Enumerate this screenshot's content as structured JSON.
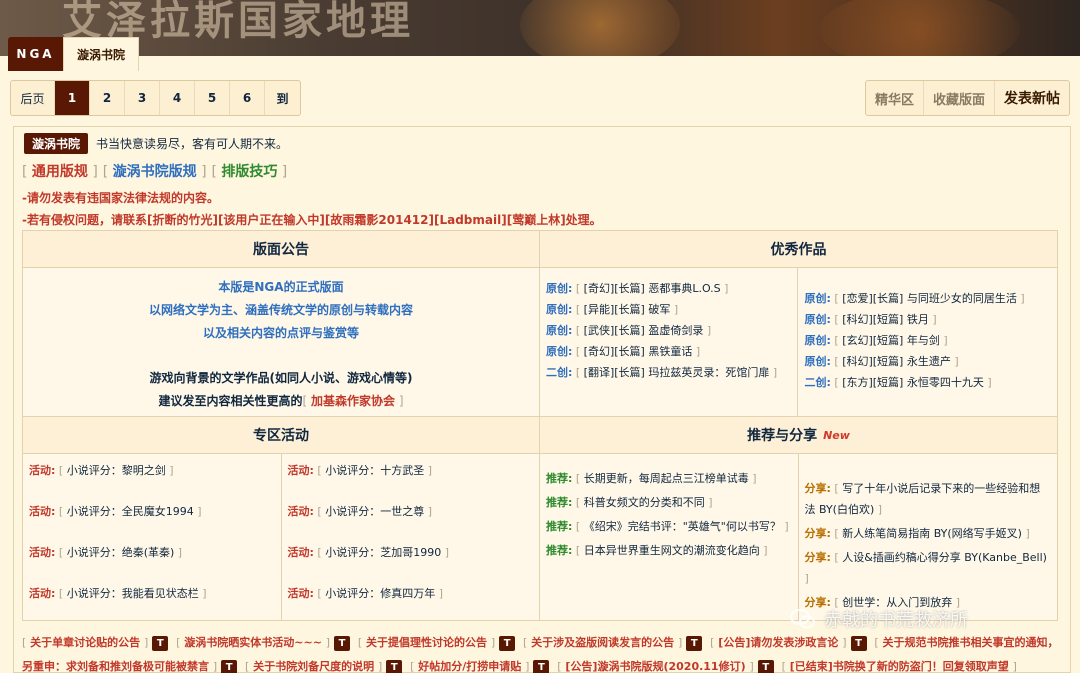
{
  "banner": {
    "title": "艾泽拉斯国家地理"
  },
  "breadcrumb": {
    "site": "NGA",
    "board": "漩涡书院"
  },
  "pager": {
    "prev": "后页",
    "pages": [
      "1",
      "2",
      "3",
      "4",
      "5",
      "6"
    ],
    "current": "1",
    "goto": "到"
  },
  "toolbar": {
    "featured": "精华区",
    "favorite": "收藏版面",
    "new_post": "发表新帖"
  },
  "intro": {
    "tag": "漩涡书院",
    "text": "书当快意读易尽，客有可人期不来。"
  },
  "rule_links": [
    "通用版规",
    "漩涡书院版规",
    "排版技巧"
  ],
  "warnings": [
    "-请勿发表有违国家法律法规的内容。",
    "-若有侵权问题，请联系[折断的竹光][该用户正在输入中][故雨霜影201412][Ladbmail][莺巅上林]处理。"
  ],
  "sections": {
    "announcement": {
      "title": "版面公告",
      "lines_blue": [
        "本版是NGA的正式版面",
        "以网络文学为主、涵盖传统文学的原创与转载内容",
        "以及相关内容的点评与鉴赏等"
      ],
      "lines_dark": [
        "游戏向背景的文学作品(如同人小说、游戏心情等)",
        "建议发至内容相关性更高的"
      ],
      "link": "加基森作家协会"
    },
    "works": {
      "title": "优秀作品",
      "left": [
        {
          "label": "原创:",
          "text": "[奇幻][长篇] 恶都事典L.O.S"
        },
        {
          "label": "原创:",
          "text": "[异能][长篇] 破军"
        },
        {
          "label": "原创:",
          "text": "[武侠][长篇] 盈虚倚剑录"
        },
        {
          "label": "原创:",
          "text": "[奇幻][长篇] 黑铁童话"
        },
        {
          "label": "二创:",
          "text": "[翻译][长篇] 玛拉兹英灵录：死馆门扉"
        }
      ],
      "right": [
        {
          "label": "原创:",
          "text": "[恋爱][长篇] 与同班少女的同居生活"
        },
        {
          "label": "原创:",
          "text": "[科幻][短篇] 铁月"
        },
        {
          "label": "原创:",
          "text": "[玄幻][短篇] 年与剑"
        },
        {
          "label": "原创:",
          "text": "[科幻][短篇] 永生遗产"
        },
        {
          "label": "二创:",
          "text": "[东方][短篇] 永恒零四十九天"
        }
      ]
    },
    "activities": {
      "title": "专区活动",
      "col1": [
        {
          "label": "活动:",
          "text": "小说评分：黎明之剑"
        },
        {
          "label": "活动:",
          "text": "小说评分：全民魔女1994"
        },
        {
          "label": "活动:",
          "text": "小说评分：绝秦(革秦)"
        },
        {
          "label": "活动:",
          "text": "小说评分：我能看见状态栏"
        }
      ],
      "col2": [
        {
          "label": "活动:",
          "text": "小说评分：十方武圣"
        },
        {
          "label": "活动:",
          "text": "小说评分：一世之尊"
        },
        {
          "label": "活动:",
          "text": "小说评分：芝加哥1990"
        },
        {
          "label": "活动:",
          "text": "小说评分：修真四万年"
        }
      ]
    },
    "recommend": {
      "title": "推荐与分享",
      "badge": "New",
      "left": [
        {
          "label": "推荐:",
          "text": "长期更新，每周起点三江榜单试毒"
        },
        {
          "label": "推荐:",
          "text": "科普女频文的分类和不同"
        },
        {
          "label": "推荐:",
          "text": "《绍宋》完结书评：\"英雄气\"何以书写？"
        },
        {
          "label": "推荐:",
          "text": "日本异世界重生网文的潮流变化趋向"
        }
      ],
      "right": [
        {
          "label": "分享:",
          "text": "写了十年小说后记录下来的一些经验和想法 BY(白伯欢)"
        },
        {
          "label": "分享:",
          "text": "新人练笔简易指南 BY(网络写手姬叉)"
        },
        {
          "label": "分享:",
          "text": "人设&插画约稿心得分享 BY(Kanbe_Bell)"
        },
        {
          "label": "分享:",
          "text": "创世学：从入门到放弃"
        }
      ]
    }
  },
  "threads": [
    "关于单章讨论贴的公告",
    "漩涡书院晒实体书活动~~~",
    "关于提倡理性讨论的公告",
    "关于涉及盗版阅读发言的公告",
    "[公告]请勿发表涉政言论",
    "关于规范书院推书相关事宜的通知，另重申：求刘备和推刘备极可能被禁言",
    "关于书院刘备尺度的说明",
    "好帖加分/打捞申请贴",
    "[公告]漩涡书院版规(2020.11修订)",
    "[已结束]书院换了新的防盗门！回复领取声望"
  ],
  "thread_badge": "T",
  "watermark": "赤戟的书荒救济所"
}
